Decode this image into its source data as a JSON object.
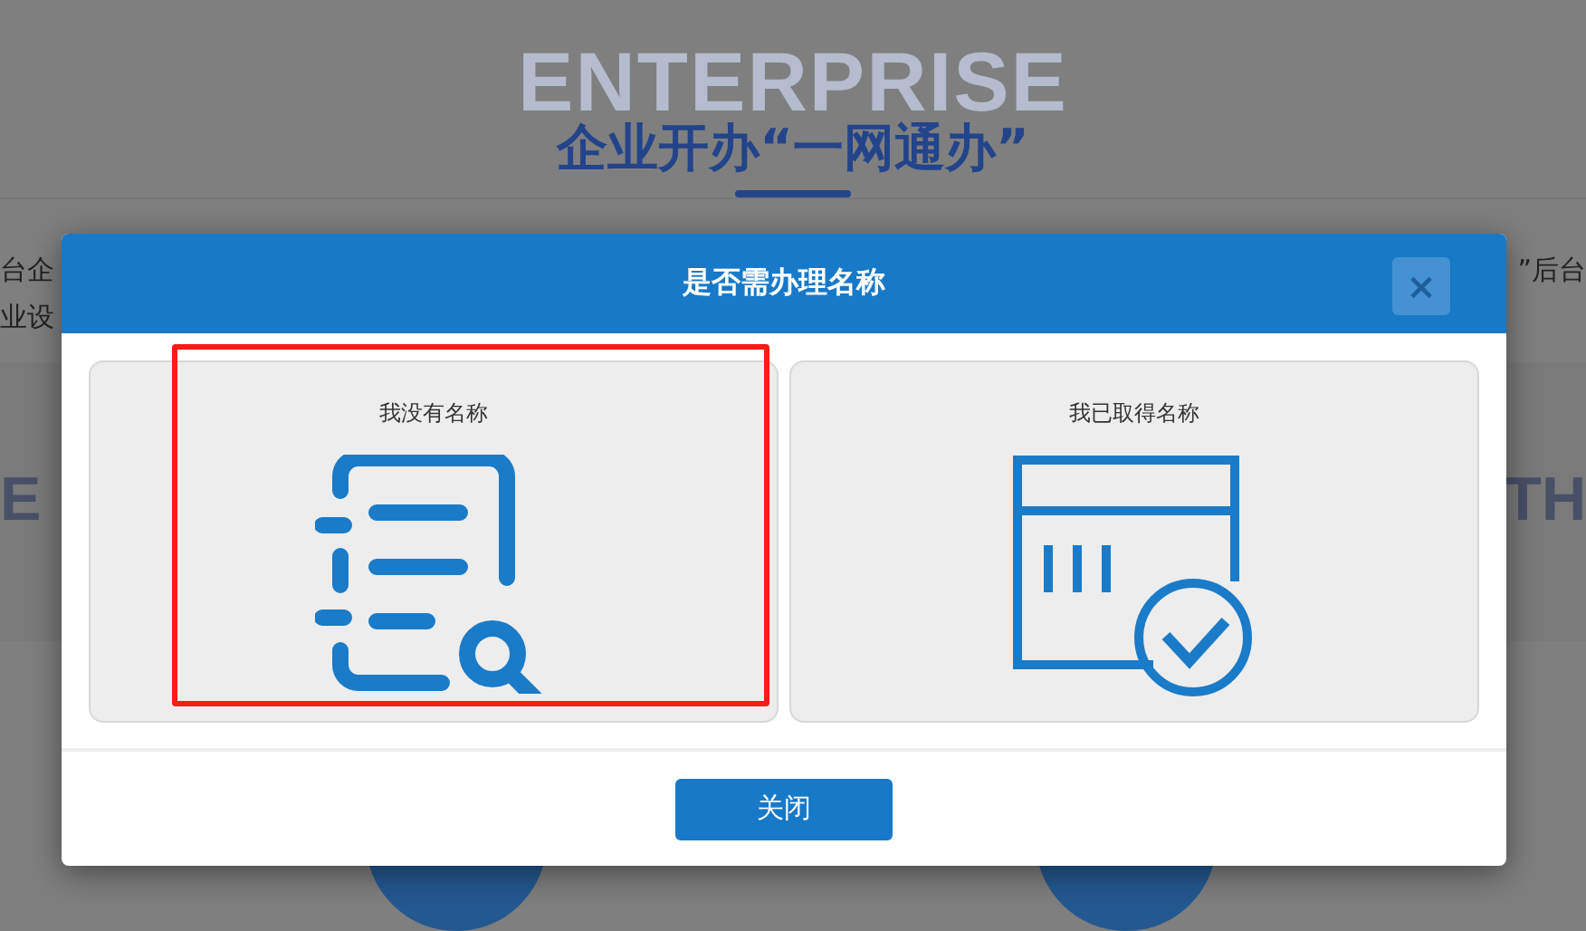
{
  "page": {
    "backdrop_word": "ENTERPRISE",
    "title": "企业开办“一网通办”",
    "left_lines": [
      "台企",
      "业设"
    ],
    "right_lines": [
      "”后台"
    ],
    "left_fragment": "E",
    "right_fragment": "TH"
  },
  "dialog": {
    "title": "是否需办理名称",
    "close_label": "×",
    "options": [
      {
        "kind": "no_name",
        "label": "我没有名称",
        "highlighted": true
      },
      {
        "kind": "has_name",
        "label": "我已取得名称",
        "highlighted": false
      }
    ],
    "button": "关闭"
  }
}
